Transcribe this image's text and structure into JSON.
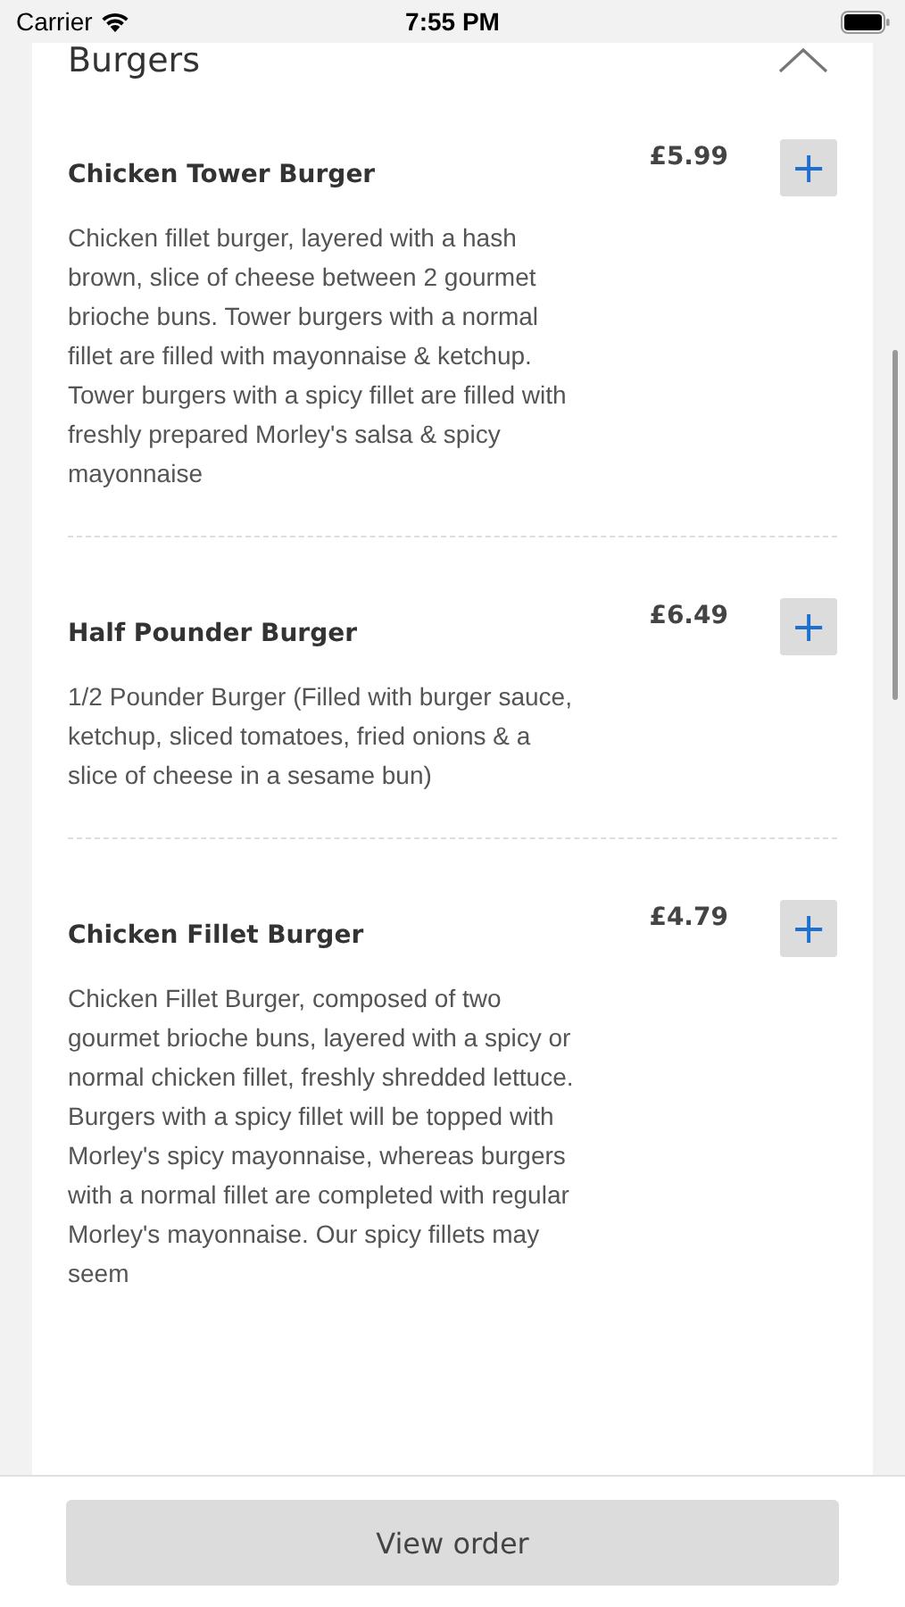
{
  "status_bar": {
    "carrier": "Carrier",
    "time": "7:55 PM"
  },
  "section": {
    "title": "Burgers",
    "expanded": true
  },
  "items": [
    {
      "name": "Chicken Tower Burger",
      "price": "£5.99",
      "add": "+",
      "description": "Chicken fillet burger, layered with a hash brown, slice of cheese between 2 gourmet brioche buns. Tower burgers with a normal fillet are filled with mayonnaise & ketchup. Tower burgers with a spicy fillet are filled with freshly prepared Morley's salsa & spicy mayonnaise"
    },
    {
      "name": "Half Pounder Burger",
      "price": "£6.49",
      "add": "+",
      "description": "1/2 Pounder Burger (Filled with burger sauce, ketchup, sliced tomatoes, fried onions & a slice of cheese in a sesame bun)"
    },
    {
      "name": "Chicken Fillet Burger",
      "price": "£4.79",
      "add": "+",
      "description": "Chicken Fillet Burger, composed of two gourmet brioche buns, layered with a spicy or normal chicken fillet, freshly shredded lettuce. Burgers with a spicy fillet will be topped with Morley's spicy mayonnaise, whereas burgers with a normal fillet are completed with regular Morley's mayonnaise. Our spicy fillets may seem"
    }
  ],
  "footer": {
    "button": "View order"
  }
}
